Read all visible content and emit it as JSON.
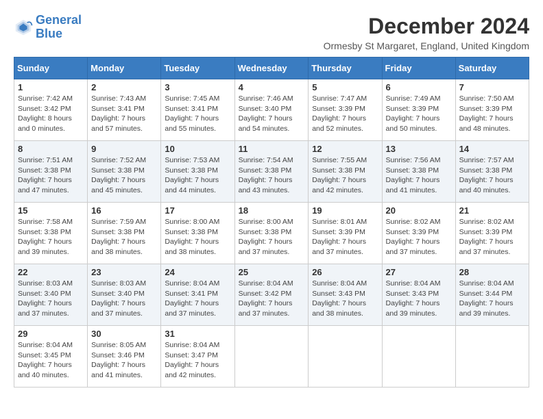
{
  "header": {
    "logo_line1": "General",
    "logo_line2": "Blue",
    "month_title": "December 2024",
    "location": "Ormesby St Margaret, England, United Kingdom"
  },
  "weekdays": [
    "Sunday",
    "Monday",
    "Tuesday",
    "Wednesday",
    "Thursday",
    "Friday",
    "Saturday"
  ],
  "weeks": [
    [
      {
        "day": "1",
        "sunrise": "Sunrise: 7:42 AM",
        "sunset": "Sunset: 3:42 PM",
        "daylight": "Daylight: 8 hours and 0 minutes."
      },
      {
        "day": "2",
        "sunrise": "Sunrise: 7:43 AM",
        "sunset": "Sunset: 3:41 PM",
        "daylight": "Daylight: 7 hours and 57 minutes."
      },
      {
        "day": "3",
        "sunrise": "Sunrise: 7:45 AM",
        "sunset": "Sunset: 3:41 PM",
        "daylight": "Daylight: 7 hours and 55 minutes."
      },
      {
        "day": "4",
        "sunrise": "Sunrise: 7:46 AM",
        "sunset": "Sunset: 3:40 PM",
        "daylight": "Daylight: 7 hours and 54 minutes."
      },
      {
        "day": "5",
        "sunrise": "Sunrise: 7:47 AM",
        "sunset": "Sunset: 3:39 PM",
        "daylight": "Daylight: 7 hours and 52 minutes."
      },
      {
        "day": "6",
        "sunrise": "Sunrise: 7:49 AM",
        "sunset": "Sunset: 3:39 PM",
        "daylight": "Daylight: 7 hours and 50 minutes."
      },
      {
        "day": "7",
        "sunrise": "Sunrise: 7:50 AM",
        "sunset": "Sunset: 3:39 PM",
        "daylight": "Daylight: 7 hours and 48 minutes."
      }
    ],
    [
      {
        "day": "8",
        "sunrise": "Sunrise: 7:51 AM",
        "sunset": "Sunset: 3:38 PM",
        "daylight": "Daylight: 7 hours and 47 minutes."
      },
      {
        "day": "9",
        "sunrise": "Sunrise: 7:52 AM",
        "sunset": "Sunset: 3:38 PM",
        "daylight": "Daylight: 7 hours and 45 minutes."
      },
      {
        "day": "10",
        "sunrise": "Sunrise: 7:53 AM",
        "sunset": "Sunset: 3:38 PM",
        "daylight": "Daylight: 7 hours and 44 minutes."
      },
      {
        "day": "11",
        "sunrise": "Sunrise: 7:54 AM",
        "sunset": "Sunset: 3:38 PM",
        "daylight": "Daylight: 7 hours and 43 minutes."
      },
      {
        "day": "12",
        "sunrise": "Sunrise: 7:55 AM",
        "sunset": "Sunset: 3:38 PM",
        "daylight": "Daylight: 7 hours and 42 minutes."
      },
      {
        "day": "13",
        "sunrise": "Sunrise: 7:56 AM",
        "sunset": "Sunset: 3:38 PM",
        "daylight": "Daylight: 7 hours and 41 minutes."
      },
      {
        "day": "14",
        "sunrise": "Sunrise: 7:57 AM",
        "sunset": "Sunset: 3:38 PM",
        "daylight": "Daylight: 7 hours and 40 minutes."
      }
    ],
    [
      {
        "day": "15",
        "sunrise": "Sunrise: 7:58 AM",
        "sunset": "Sunset: 3:38 PM",
        "daylight": "Daylight: 7 hours and 39 minutes."
      },
      {
        "day": "16",
        "sunrise": "Sunrise: 7:59 AM",
        "sunset": "Sunset: 3:38 PM",
        "daylight": "Daylight: 7 hours and 38 minutes."
      },
      {
        "day": "17",
        "sunrise": "Sunrise: 8:00 AM",
        "sunset": "Sunset: 3:38 PM",
        "daylight": "Daylight: 7 hours and 38 minutes."
      },
      {
        "day": "18",
        "sunrise": "Sunrise: 8:00 AM",
        "sunset": "Sunset: 3:38 PM",
        "daylight": "Daylight: 7 hours and 37 minutes."
      },
      {
        "day": "19",
        "sunrise": "Sunrise: 8:01 AM",
        "sunset": "Sunset: 3:39 PM",
        "daylight": "Daylight: 7 hours and 37 minutes."
      },
      {
        "day": "20",
        "sunrise": "Sunrise: 8:02 AM",
        "sunset": "Sunset: 3:39 PM",
        "daylight": "Daylight: 7 hours and 37 minutes."
      },
      {
        "day": "21",
        "sunrise": "Sunrise: 8:02 AM",
        "sunset": "Sunset: 3:39 PM",
        "daylight": "Daylight: 7 hours and 37 minutes."
      }
    ],
    [
      {
        "day": "22",
        "sunrise": "Sunrise: 8:03 AM",
        "sunset": "Sunset: 3:40 PM",
        "daylight": "Daylight: 7 hours and 37 minutes."
      },
      {
        "day": "23",
        "sunrise": "Sunrise: 8:03 AM",
        "sunset": "Sunset: 3:40 PM",
        "daylight": "Daylight: 7 hours and 37 minutes."
      },
      {
        "day": "24",
        "sunrise": "Sunrise: 8:04 AM",
        "sunset": "Sunset: 3:41 PM",
        "daylight": "Daylight: 7 hours and 37 minutes."
      },
      {
        "day": "25",
        "sunrise": "Sunrise: 8:04 AM",
        "sunset": "Sunset: 3:42 PM",
        "daylight": "Daylight: 7 hours and 37 minutes."
      },
      {
        "day": "26",
        "sunrise": "Sunrise: 8:04 AM",
        "sunset": "Sunset: 3:43 PM",
        "daylight": "Daylight: 7 hours and 38 minutes."
      },
      {
        "day": "27",
        "sunrise": "Sunrise: 8:04 AM",
        "sunset": "Sunset: 3:43 PM",
        "daylight": "Daylight: 7 hours and 39 minutes."
      },
      {
        "day": "28",
        "sunrise": "Sunrise: 8:04 AM",
        "sunset": "Sunset: 3:44 PM",
        "daylight": "Daylight: 7 hours and 39 minutes."
      }
    ],
    [
      {
        "day": "29",
        "sunrise": "Sunrise: 8:04 AM",
        "sunset": "Sunset: 3:45 PM",
        "daylight": "Daylight: 7 hours and 40 minutes."
      },
      {
        "day": "30",
        "sunrise": "Sunrise: 8:05 AM",
        "sunset": "Sunset: 3:46 PM",
        "daylight": "Daylight: 7 hours and 41 minutes."
      },
      {
        "day": "31",
        "sunrise": "Sunrise: 8:04 AM",
        "sunset": "Sunset: 3:47 PM",
        "daylight": "Daylight: 7 hours and 42 minutes."
      },
      null,
      null,
      null,
      null
    ]
  ]
}
